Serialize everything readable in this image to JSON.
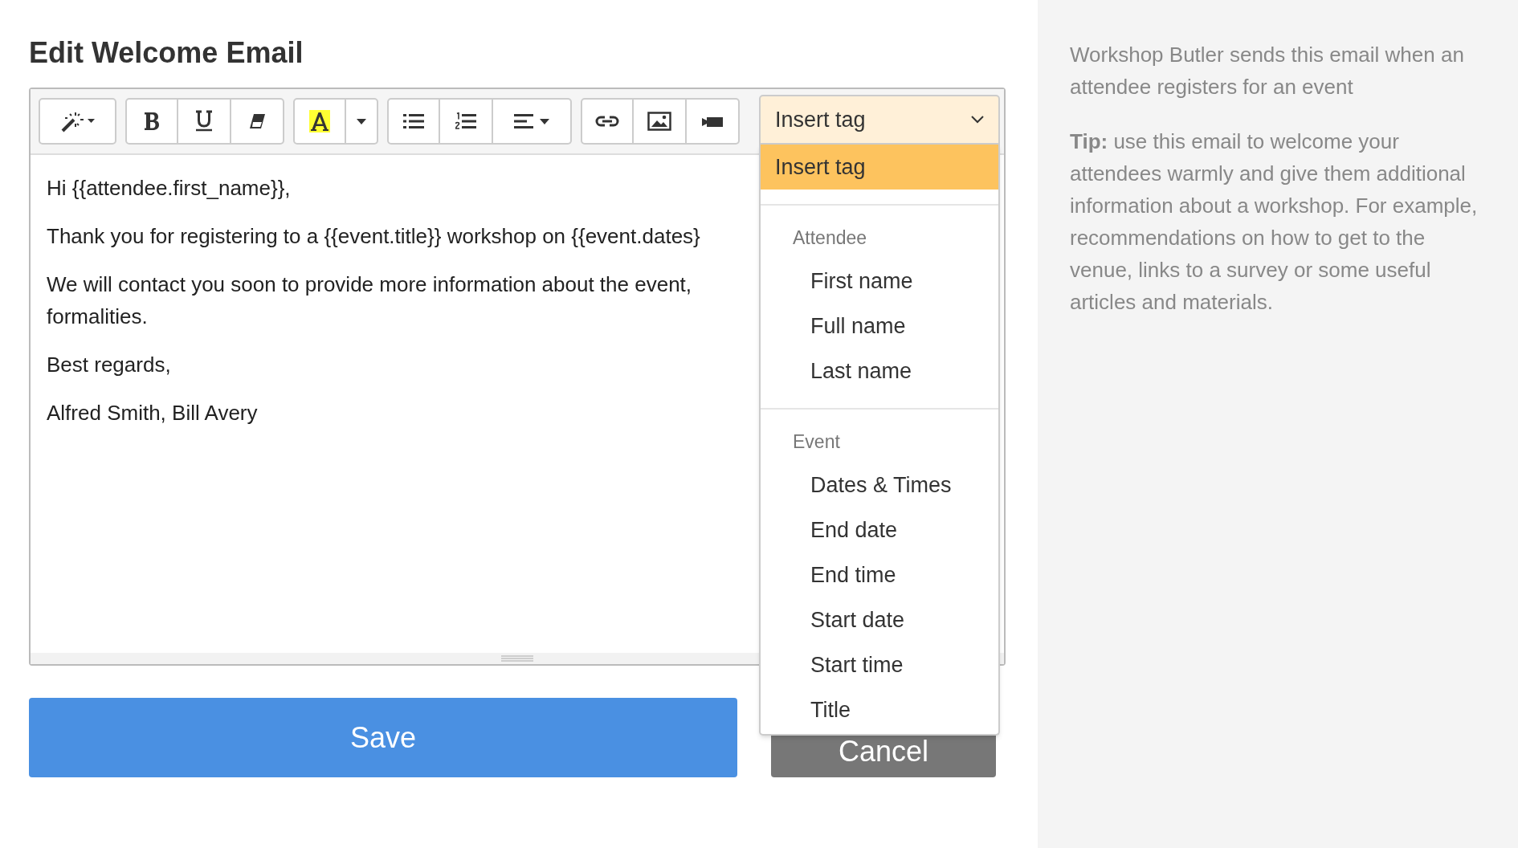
{
  "page": {
    "title": "Edit Welcome Email"
  },
  "editor": {
    "paragraphs": [
      {
        "lines": [
          "Hi {{attendee.first_name}},"
        ]
      },
      {
        "lines": [
          "Thank you for registering to a {{event.title}} workshop on {{event.dates}"
        ]
      },
      {
        "lines": [
          "We will contact you soon to provide more information about the event,",
          "formalities."
        ]
      },
      {
        "lines": [
          "Best regards,"
        ]
      },
      {
        "lines": [
          "Alfred Smith, Bill Avery"
        ]
      }
    ]
  },
  "tag_dropdown": {
    "value": "Insert tag",
    "expanded": true,
    "options": [
      {
        "label": "Insert tag",
        "selected": true
      }
    ],
    "groups": [
      {
        "header": "Attendee",
        "items": [
          {
            "label": "First name",
            "selected": false
          },
          {
            "label": "Full name",
            "selected": false
          },
          {
            "label": "Last name",
            "selected": false
          }
        ]
      },
      {
        "header": "Event",
        "items": [
          {
            "label": "Dates & Times",
            "selected": false
          },
          {
            "label": "End date",
            "selected": false
          },
          {
            "label": "End time",
            "selected": false
          },
          {
            "label": "Start date",
            "selected": false
          },
          {
            "label": "Start time",
            "selected": false
          },
          {
            "label": "Title",
            "selected": false
          }
        ]
      }
    ]
  },
  "buttons": [
    {
      "label": "Save",
      "kind": "primary"
    },
    {
      "label": "Cancel",
      "kind": "secondary"
    }
  ],
  "sidebar": {
    "description": "Workshop Butler sends this email when an attendee registers for an event",
    "tip": "**Tip:** use this email to welcome your attendees warmly and give them additional information about a workshop. For example, recommendations on how to get to the venue, links to a survey or some useful articles and materials."
  }
}
